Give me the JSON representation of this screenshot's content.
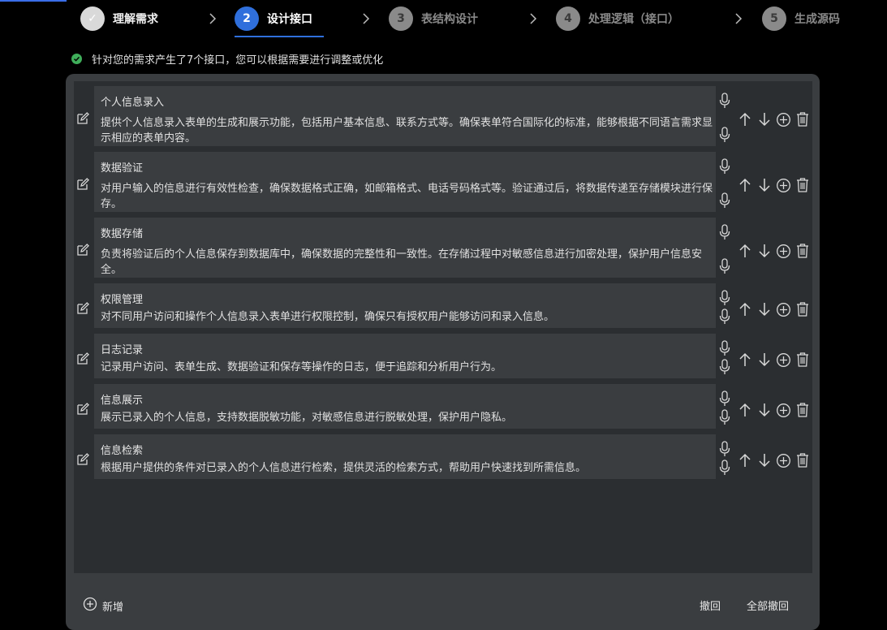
{
  "steps": [
    {
      "num": "✓",
      "label": "理解需求",
      "state": "done"
    },
    {
      "num": "2",
      "label": "设计接口",
      "state": "active"
    },
    {
      "num": "3",
      "label": "表结构设计",
      "state": "todo"
    },
    {
      "num": "4",
      "label": "处理逻辑（接口）",
      "state": "todo"
    },
    {
      "num": "5",
      "label": "生成源码",
      "state": "todo"
    }
  ],
  "message": "针对您的需求产生了7个接口，您可以根据需要进行调整或优化",
  "interfaces": [
    {
      "title": "个人信息录入",
      "desc": "提供个人信息录入表单的生成和展示功能，包括用户基本信息、联系方式等。确保表单符合国际化的标准，能够根据不同语言需求显示相应的表单内容。"
    },
    {
      "title": "数据验证",
      "desc": "对用户输入的信息进行有效性检查，确保数据格式正确，如邮箱格式、电话号码格式等。验证通过后，将数据传递至存储模块进行保存。"
    },
    {
      "title": "数据存储",
      "desc": "负责将验证后的个人信息保存到数据库中，确保数据的完整性和一致性。在存储过程中对敏感信息进行加密处理，保护用户信息安全。"
    },
    {
      "title": "权限管理",
      "desc": "对不同用户访问和操作个人信息录入表单进行权限控制，确保只有授权用户能够访问和录入信息。"
    },
    {
      "title": "日志记录",
      "desc": "记录用户访问、表单生成、数据验证和保存等操作的日志，便于追踪和分析用户行为。"
    },
    {
      "title": "信息展示",
      "desc": "展示已录入的个人信息，支持数据脱敏功能，对敏感信息进行脱敏处理，保护用户隐私。"
    },
    {
      "title": "信息检索",
      "desc": "根据用户提供的条件对已录入的个人信息进行检索，提供灵活的检索方式，帮助用户快速找到所需信息。"
    }
  ],
  "footer": {
    "add_label": "新增",
    "undo_label": "撤回",
    "undo_all_label": "全部撤回"
  },
  "colors": {
    "accent": "#2f6fdc",
    "success": "#3fae5a",
    "panel": "#3a3d40",
    "list_bg": "#2b2e31"
  }
}
